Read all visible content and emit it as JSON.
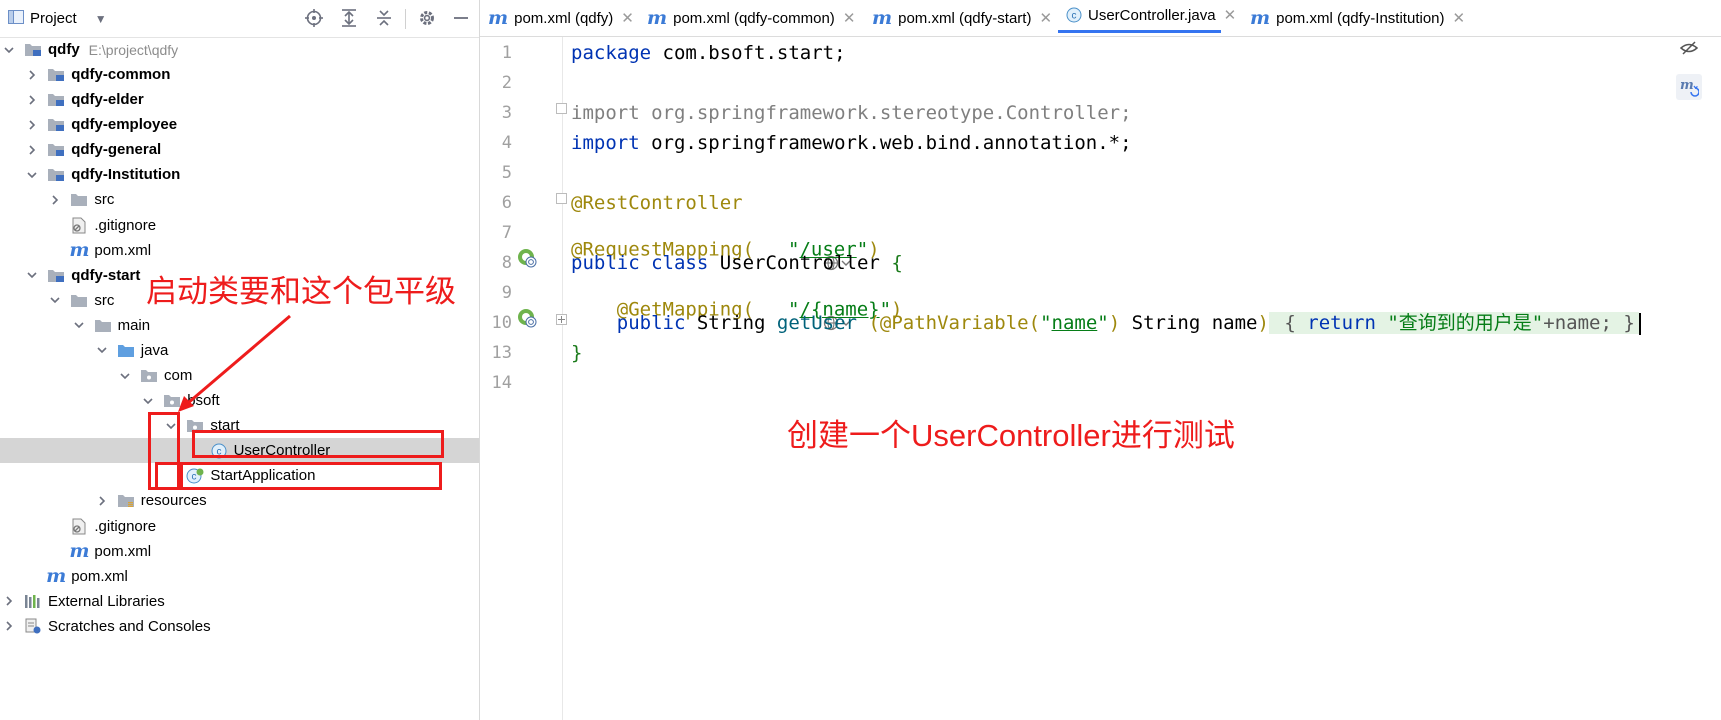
{
  "project_panel": {
    "title": "Project",
    "tree": [
      {
        "label": "qdfy",
        "path": "E:\\project\\qdfy",
        "bold": true,
        "indent": 0,
        "icon": "module-folder-icon",
        "arrow": "down"
      },
      {
        "label": "qdfy-common",
        "bold": true,
        "indent": 1,
        "icon": "module-folder-icon",
        "arrow": "right"
      },
      {
        "label": "qdfy-elder",
        "bold": true,
        "indent": 1,
        "icon": "module-folder-icon",
        "arrow": "right"
      },
      {
        "label": "qdfy-employee",
        "bold": true,
        "indent": 1,
        "icon": "module-folder-icon",
        "arrow": "right"
      },
      {
        "label": "qdfy-general",
        "bold": true,
        "indent": 1,
        "icon": "module-folder-icon",
        "arrow": "right"
      },
      {
        "label": "qdfy-Institution",
        "bold": true,
        "indent": 1,
        "icon": "module-folder-icon",
        "arrow": "down"
      },
      {
        "label": "src",
        "indent": 2,
        "icon": "folder-icon",
        "arrow": "right"
      },
      {
        "label": ".gitignore",
        "indent": 2,
        "icon": "gitignore-icon",
        "arrow": ""
      },
      {
        "label": "pom.xml",
        "indent": 2,
        "icon": "maven-icon",
        "arrow": ""
      },
      {
        "label": "qdfy-start",
        "bold": true,
        "indent": 1,
        "icon": "module-folder-icon",
        "arrow": "down"
      },
      {
        "label": "src",
        "indent": 2,
        "icon": "folder-icon",
        "arrow": "down"
      },
      {
        "label": "main",
        "indent": 3,
        "icon": "folder-icon",
        "arrow": "down"
      },
      {
        "label": "java",
        "indent": 4,
        "icon": "source-folder-icon",
        "arrow": "down"
      },
      {
        "label": "com",
        "indent": 5,
        "icon": "package-icon",
        "arrow": "down"
      },
      {
        "label": "bsoft",
        "indent": 6,
        "icon": "package-icon",
        "arrow": "down"
      },
      {
        "label": "start",
        "indent": 7,
        "icon": "package-icon",
        "arrow": "down"
      },
      {
        "label": "UserController",
        "indent": 8,
        "icon": "class-icon",
        "arrow": "",
        "selected": true
      },
      {
        "label": "StartApplication",
        "indent": 7,
        "icon": "spring-class-icon",
        "arrow": ""
      },
      {
        "label": "resources",
        "indent": 4,
        "icon": "resources-folder-icon",
        "arrow": "right"
      },
      {
        "label": ".gitignore",
        "indent": 2,
        "icon": "gitignore-icon",
        "arrow": ""
      },
      {
        "label": "pom.xml",
        "indent": 2,
        "icon": "maven-icon",
        "arrow": ""
      },
      {
        "label": "pom.xml",
        "indent": 1,
        "icon": "maven-icon",
        "arrow": ""
      },
      {
        "label": "External Libraries",
        "indent": 0,
        "icon": "libraries-icon",
        "arrow": "right"
      },
      {
        "label": "Scratches and Consoles",
        "indent": 0,
        "icon": "scratches-icon",
        "arrow": "right"
      }
    ]
  },
  "tabs": [
    {
      "label": "pom.xml (qdfy)",
      "icon": "maven-icon",
      "active": false
    },
    {
      "label": "pom.xml (qdfy-common)",
      "icon": "maven-icon",
      "active": false
    },
    {
      "label": "pom.xml (qdfy-start)",
      "icon": "maven-icon",
      "active": false
    },
    {
      "label": "UserController.java",
      "icon": "class-icon",
      "active": true
    },
    {
      "label": "pom.xml (qdfy-Institution)",
      "icon": "maven-icon",
      "active": false
    }
  ],
  "editor": {
    "line_numbers": [
      "1",
      "2",
      "3",
      "4",
      "5",
      "6",
      "7",
      "8",
      "9",
      "10",
      "13",
      "14"
    ],
    "code": {
      "l1_kw": "package",
      "l1_rest": " com.bsoft.start;",
      "l3_kw": "import",
      "l3_rest": " org.springframework.stereotype.Controller;",
      "l4_kw": "import",
      "l4_rest": " org.springframework.web.bind.annotation.*;",
      "l6_an": "@RestController",
      "l7_an": "@RequestMapping(",
      "l7_q1": "\"",
      "l7_path": "/user",
      "l7_q2": "\"",
      "l7_end": ")",
      "l8_kw": "public class",
      "l8_name": " UserController ",
      "l8_brace": "{",
      "l9_indent": "    ",
      "l9_an": "@GetMapping(",
      "l9_q1": "\"",
      "l9_path": "/{name}",
      "l9_q2": "\"",
      "l9_end": ")",
      "l10_indent": "    ",
      "l10_kw": "public",
      "l10_type": " String ",
      "l10_fn": "getUser",
      "l10_open": " (",
      "l10_an": "@PathVariable",
      "l10_p1": "(",
      "l10_q1": "\"",
      "l10_arg": "name",
      "l10_q2": "\"",
      "l10_p2": ")",
      "l10_param": " String name",
      "l10_close": ")",
      "l10_fold_open": " { ",
      "l10_ret": "return",
      "l10_str_q1": " \"",
      "l10_str_cn": "查询到的用户是",
      "l10_str_q2": "\"",
      "l10_concat": "+name; ",
      "l10_fold_close": "}",
      "l13_brace": "}"
    }
  },
  "annotations": {
    "tree_note": "启动类要和这个包平级",
    "code_note": "创建一个UserController进行测试"
  },
  "colors": {
    "keyword": "#0033b3",
    "annotation": "#9e880d",
    "string": "#067d17",
    "annotation_red": "#ee1c1c",
    "selection": "#d5d5d5",
    "active_tab_underline": "#3574f0"
  }
}
